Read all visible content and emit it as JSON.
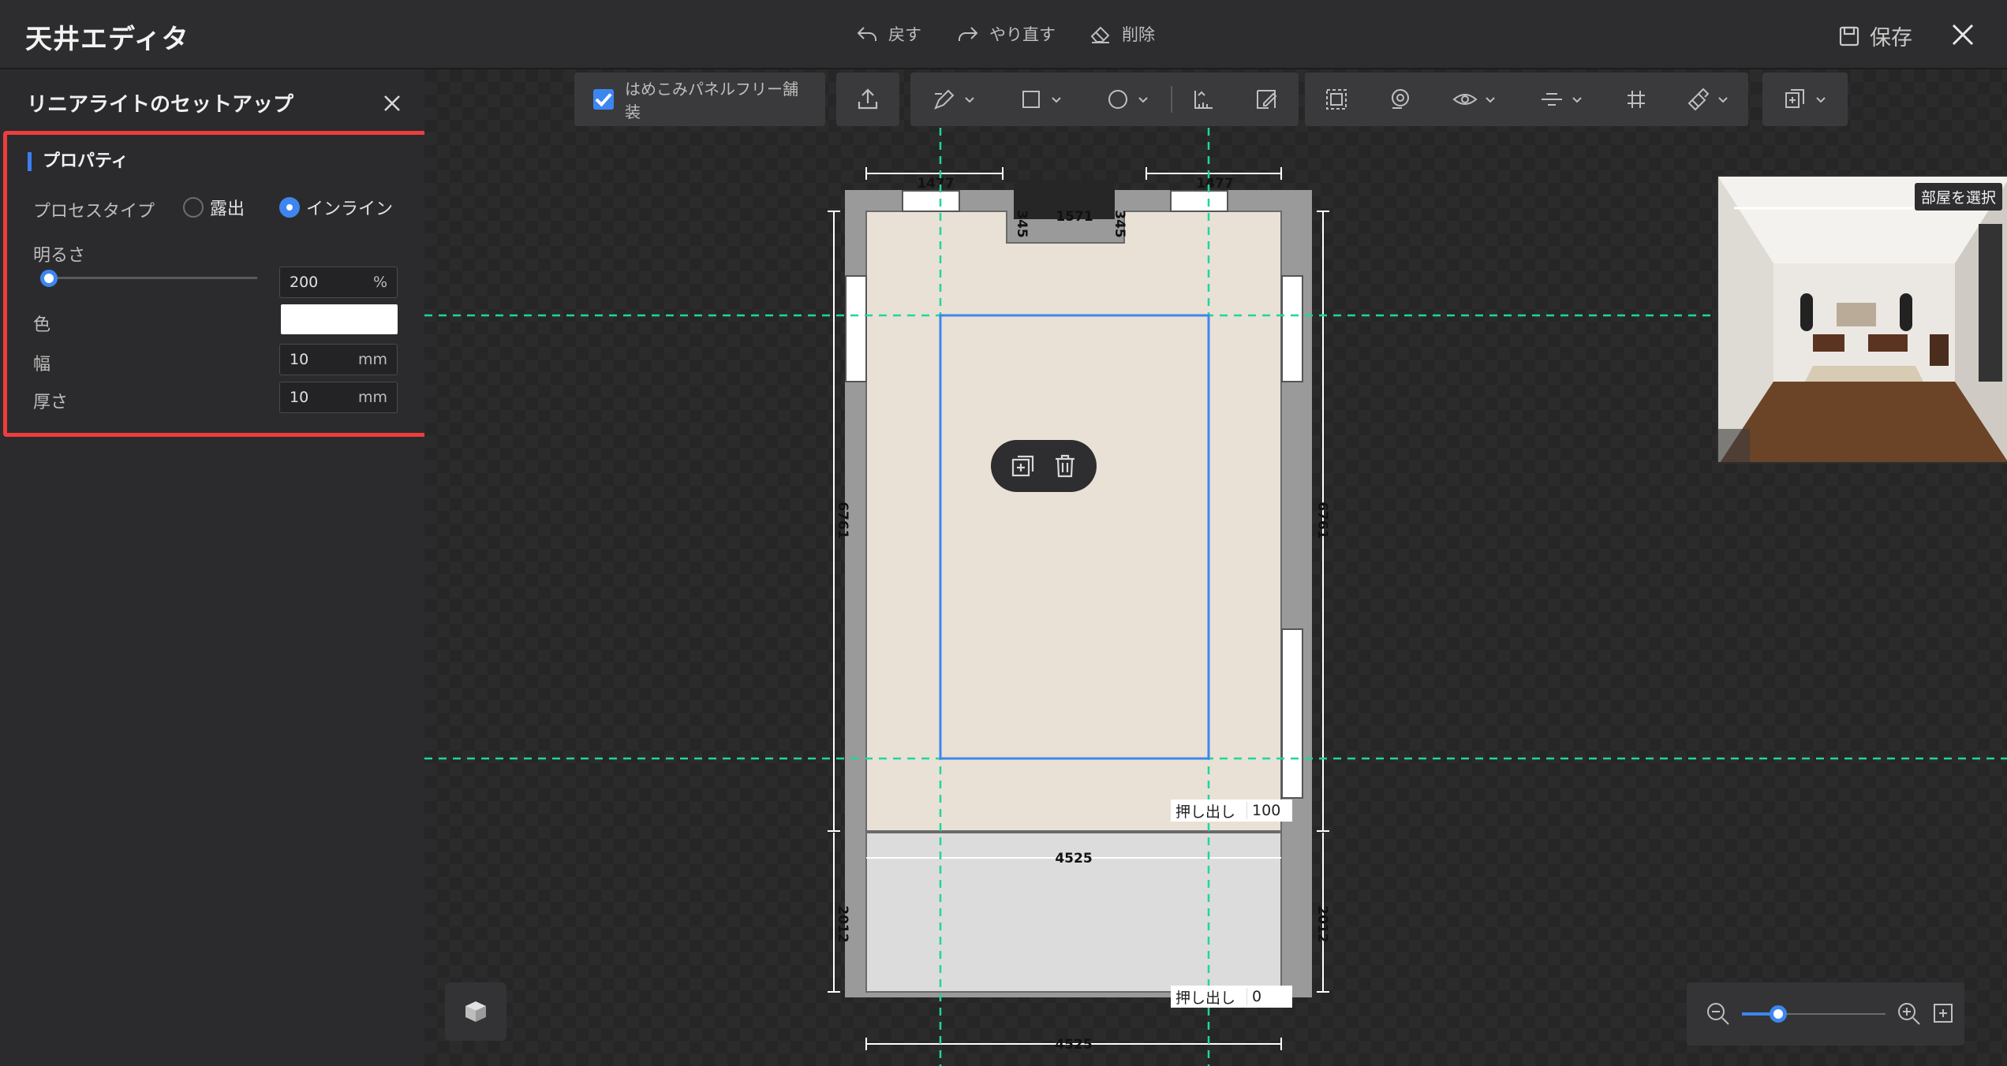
{
  "app": {
    "title": "天井エディタ"
  },
  "header": {
    "undo_label": "戻す",
    "redo_label": "やり直す",
    "delete_label": "削除",
    "save_label": "保存"
  },
  "panel": {
    "title": "リニアライトのセットアップ",
    "section_title": "プロパティ",
    "process_type_label": "プロセスタイプ",
    "process_options": [
      "露出",
      "インライン"
    ],
    "process_selected": "インライン",
    "brightness_label": "明るさ",
    "brightness_value": "200",
    "brightness_unit": "%",
    "color_label": "色",
    "color_value": "#ffffff",
    "width_label": "幅",
    "width_value": "10",
    "width_unit": "mm",
    "thickness_label": "厚さ",
    "thickness_value": "10",
    "thickness_unit": "mm"
  },
  "toolbar": {
    "seamless_label": "はめこみパネルフリー舗装",
    "seamless_checked": true,
    "tools": [
      "upload-icon",
      "pen-icon",
      "rectangle-icon",
      "circle-icon",
      "ruler-icon",
      "edit-icon",
      "select-area-icon",
      "lasso-icon",
      "eye-icon",
      "align-icon",
      "grid-icon",
      "paint-icon",
      "copy-icon"
    ]
  },
  "plan": {
    "dims": {
      "top_left": "1477",
      "top_right": "1477",
      "top_mid": "1571",
      "notch_left": "345",
      "notch_right": "345",
      "side_upper": "6761",
      "side_lower": "2012",
      "width_mid": "4525",
      "width_bottom": "4525"
    },
    "extrude_label": "押し出し",
    "extrude_upper": "100",
    "extrude_lower": "0"
  },
  "preview": {
    "room_select_label": "部屋を選択"
  },
  "zoom": {
    "level": 0.25
  },
  "colors": {
    "accent": "#3d86ef",
    "highlight_red": "#ee3d3d",
    "guide_green": "#1fd6a0",
    "ceiling_beige": "#e9e1d5",
    "ceiling_grey": "#dcdcdc"
  }
}
